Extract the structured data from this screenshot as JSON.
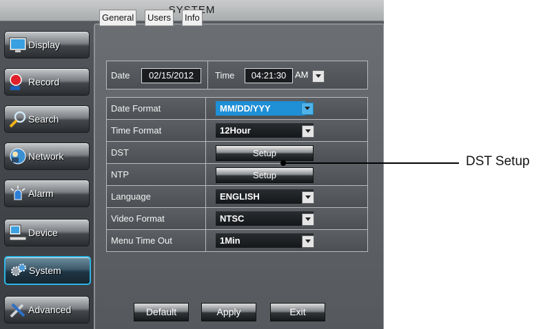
{
  "window": {
    "title": "SYSTEM"
  },
  "sidebar": {
    "items": [
      {
        "label": "Display",
        "icon": "monitor-icon"
      },
      {
        "label": "Record",
        "icon": "record-icon"
      },
      {
        "label": "Search",
        "icon": "magnifier-icon"
      },
      {
        "label": "Network",
        "icon": "network-icon"
      },
      {
        "label": "Alarm",
        "icon": "alarm-icon"
      },
      {
        "label": "Device",
        "icon": "device-icon"
      },
      {
        "label": "System",
        "icon": "gears-icon",
        "active": true
      },
      {
        "label": "Advanced",
        "icon": "tools-icon"
      }
    ]
  },
  "tabs": [
    {
      "label": "General",
      "active": true
    },
    {
      "label": "Users"
    },
    {
      "label": "Info"
    }
  ],
  "datetime": {
    "date_label": "Date",
    "date_value": "02/15/2012",
    "time_label": "Time",
    "time_value": "04:21:30",
    "ampm": "AM"
  },
  "settings": [
    {
      "label": "Date Format",
      "value": "MM/DD/YYY"
    },
    {
      "label": "Time Format",
      "value": "12Hour"
    },
    {
      "label": "DST",
      "button": "Setup"
    },
    {
      "label": "NTP",
      "button": "Setup"
    },
    {
      "label": "Language",
      "value": "ENGLISH"
    },
    {
      "label": "Video Format",
      "value": "NTSC"
    },
    {
      "label": "Menu Time Out",
      "value": "1Min"
    }
  ],
  "buttons": {
    "default": "Default",
    "apply": "Apply",
    "exit": "Exit"
  },
  "callout": {
    "text": "DST Setup"
  },
  "colors": {
    "accent": "#2bb6e6",
    "highlight": "#1f8fd6"
  }
}
